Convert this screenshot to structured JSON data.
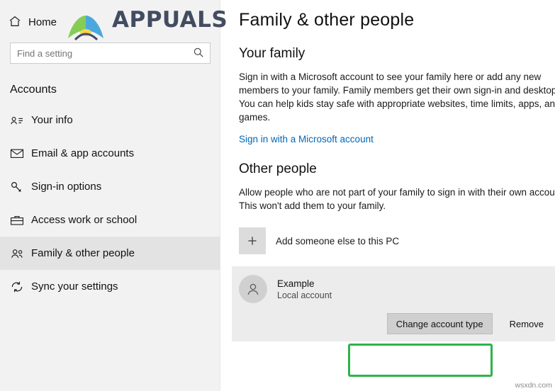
{
  "sidebar": {
    "home": {
      "label": "Home",
      "icon": "home-icon"
    },
    "search": {
      "placeholder": "Find a setting",
      "value": "",
      "icon": "search-icon"
    },
    "section_title": "Accounts",
    "items": [
      {
        "label": "Your info",
        "icon": "user-card-icon",
        "selected": false
      },
      {
        "label": "Email & app accounts",
        "icon": "envelope-icon",
        "selected": false
      },
      {
        "label": "Sign-in options",
        "icon": "key-icon",
        "selected": false
      },
      {
        "label": "Access work or school",
        "icon": "briefcase-icon",
        "selected": false
      },
      {
        "label": "Family & other people",
        "icon": "people-icon",
        "selected": true
      },
      {
        "label": "Sync your settings",
        "icon": "sync-icon",
        "selected": false
      }
    ]
  },
  "main": {
    "page_title": "Family & other people",
    "family": {
      "heading": "Your family",
      "body": "Sign in with a Microsoft account to see your family here or add any new members to your family. Family members get their own sign-in and desktop. You can help kids stay safe with appropriate websites, time limits, apps, and games.",
      "link": "Sign in with a Microsoft account"
    },
    "other_people": {
      "heading": "Other people",
      "body": "Allow people who are not part of your family to sign in with their own accounts. This won't add them to your family.",
      "add_tile": {
        "label": "Add someone else to this PC",
        "icon": "plus-icon"
      },
      "account": {
        "name": "Example",
        "type": "Local account",
        "avatar_icon": "person-icon",
        "buttons": {
          "change_type": "Change account type",
          "remove": "Remove"
        }
      }
    }
  },
  "watermark": {
    "text": "APPUALS",
    "corner_credit": "wsxdn.com"
  },
  "colors": {
    "accent_link": "#0067b8",
    "highlight_green": "#2eb34a",
    "sidebar_bg": "#f2f2f2",
    "selected_item_bg": "#e3e3e3",
    "card_bg": "#ececec"
  }
}
